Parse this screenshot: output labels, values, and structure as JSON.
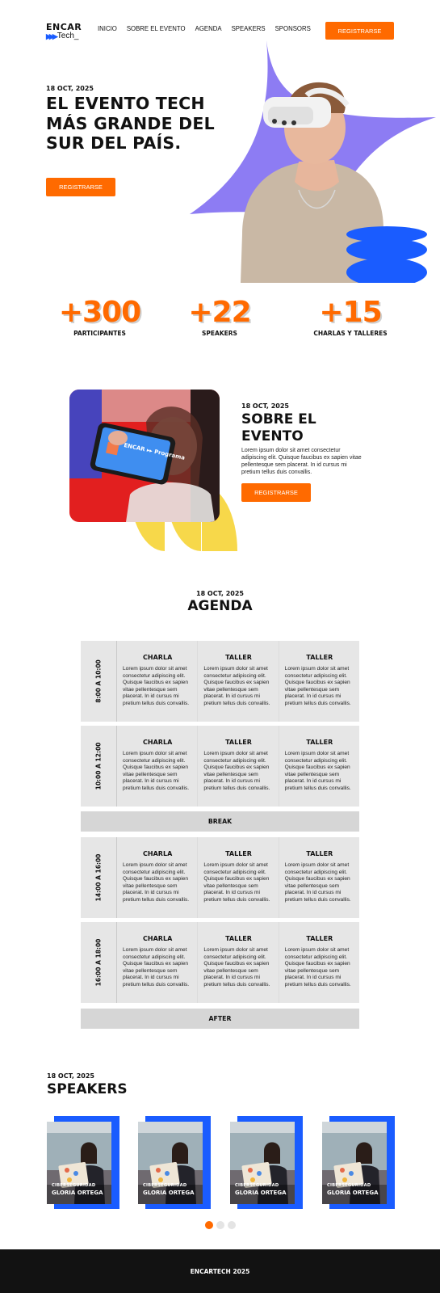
{
  "nav": {
    "logo_top": "ENCAR",
    "logo_bottom": "Tech_",
    "items": [
      "INICIO",
      "SOBRE EL EVENTO",
      "AGENDA",
      "SPEAKERS",
      "SPONSORS"
    ],
    "cta": "REGISTRARSE"
  },
  "hero": {
    "date": "18 OCT, 2025",
    "title": "EL EVENTO TECH MÁS GRANDE DEL SUR DEL PAÍS.",
    "cta": "REGISTRARSE"
  },
  "stats": [
    {
      "value": "+300",
      "label": "PARTICIPANTES"
    },
    {
      "value": "+22",
      "label": "SPEAKERS"
    },
    {
      "value": "+15",
      "label": "CHARLAS Y TALLERES"
    }
  ],
  "about": {
    "date": "18 OCT, 2025",
    "title": "SOBRE EL EVENTO",
    "text": "Lorem ipsum dolor sit amet consectetur adipiscing elit. Quisque faucibus ex sapien vitae pellentesque sem placerat. In id cursus mi pretium tellus duis convallis.",
    "cta": "REGISTRARSE",
    "phone_logo": "ENCAR ▸▸ Programa"
  },
  "agenda": {
    "date": "18 OCT, 2025",
    "title": "AGENDA",
    "lorem": "Lorem ipsum dolor sit amet consectetur adipiscing elit. Quisque faucibus ex sapien vitae pellentesque sem placerat. In id cursus mi pretium tellus duis convallis.",
    "slots": [
      {
        "time": "8:00 A 10:00",
        "cols": [
          "CHARLA",
          "TALLER",
          "TALLER"
        ]
      },
      {
        "time": "10:00 A 12:00",
        "cols": [
          "CHARLA",
          "TALLER",
          "TALLER"
        ]
      },
      {
        "time": "14:00 A 16:00",
        "cols": [
          "CHARLA",
          "TALLER",
          "TALLER"
        ]
      },
      {
        "time": "16:00 A 18:00",
        "cols": [
          "CHARLA",
          "TALLER",
          "TALLER"
        ]
      }
    ],
    "break_label": "BREAK",
    "after_label": "AFTER"
  },
  "speakers": {
    "date": "18 OCT, 2025",
    "title": "SPEAKERS",
    "cards": [
      {
        "category": "CIBERSEGURIDAD",
        "name": "GLORIA ORTEGA"
      },
      {
        "category": "CIBERSEGURIDAD",
        "name": "GLORIA ORTEGA"
      },
      {
        "category": "CIBERSEGURIDAD",
        "name": "GLORIA ORTEGA"
      },
      {
        "category": "CIBERSEGURIDAD",
        "name": "GLORIA ORTEGA"
      }
    ]
  },
  "footer": {
    "text": "ENCARTECH 2025"
  },
  "colors": {
    "accent": "#ff6a00",
    "blue": "#1a5cff",
    "purple": "#8d7cf3",
    "yellow": "#f7d84a"
  }
}
